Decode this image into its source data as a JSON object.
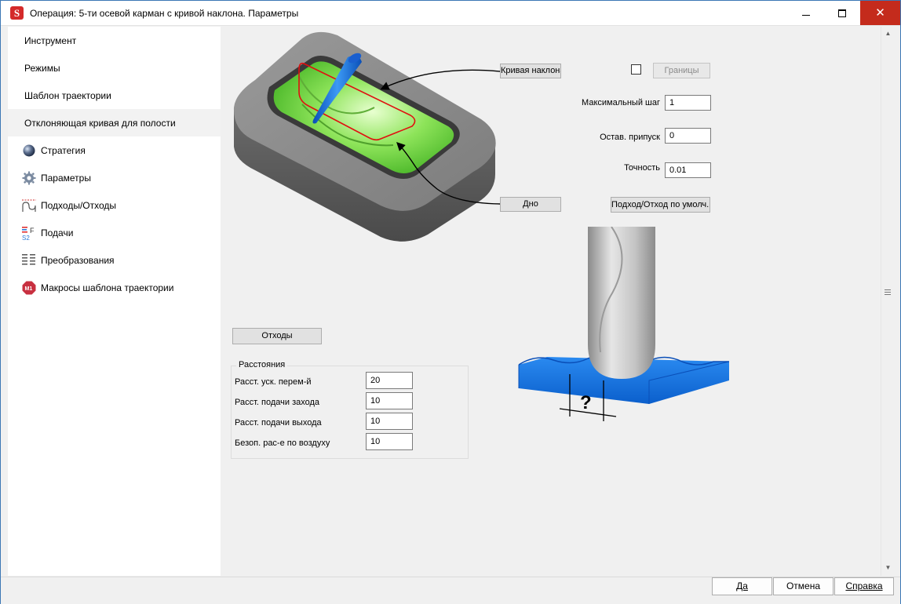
{
  "window": {
    "title": "Операция: 5-ти осевой карман с кривой наклона. Параметры",
    "app_icon_letter": "S"
  },
  "sidebar": {
    "items": [
      {
        "label": "Инструмент",
        "icon": null,
        "selected": false
      },
      {
        "label": "Режимы",
        "icon": null,
        "selected": false
      },
      {
        "label": "Шаблон траектории",
        "icon": null,
        "selected": false
      },
      {
        "label": "Отклоняющая кривая для полости",
        "icon": null,
        "selected": true
      },
      {
        "label": "Стратегия",
        "icon": "sphere-icon",
        "selected": false
      },
      {
        "label": "Параметры",
        "icon": "gear-icon",
        "selected": false
      },
      {
        "label": "Подходы/Отходы",
        "icon": "approach-retract-icon",
        "selected": false
      },
      {
        "label": "Подачи",
        "icon": "feeds-icon",
        "selected": false
      },
      {
        "label": "Преобразования",
        "icon": "transform-icon",
        "selected": false
      },
      {
        "label": "Макросы шаблона траектории",
        "icon": "macro-icon",
        "selected": false
      }
    ]
  },
  "params": {
    "tilt_curve_button": "Кривая наклона",
    "bottom_button": "Дно",
    "boundaries_checked": false,
    "boundaries_button": "Границы",
    "max_step_label": "Максимальный шаг",
    "max_step_value": "1",
    "stock_label": "Остав. припуск",
    "stock_value": "0",
    "accuracy_label": "Точность",
    "accuracy_value": "0.01",
    "default_approach_button": "Подход/Отход по умолч.",
    "retracts_button": "Отходы"
  },
  "distances": {
    "title": "Расстояния",
    "rapid_label": "Расст. уск. перем-й",
    "rapid_value": "20",
    "approach_feed_label": "Расст. подачи захода",
    "approach_feed_value": "10",
    "retract_feed_label": "Расст. подачи выхода",
    "retract_feed_value": "10",
    "safe_air_label": "Безоп. рас-е по воздуху",
    "safe_air_value": "10"
  },
  "illustration": {
    "question_mark": "?"
  },
  "dialog": {
    "ok": "Да",
    "cancel": "Отмена",
    "help": "Справка"
  },
  "colors": {
    "part_gray": "#8c8c8c",
    "pocket_green": "#7fe04f",
    "curve_red": "#e01010",
    "tool_blue": "#1a6fe0",
    "plate_blue": "#1e78e6",
    "close_red": "#c42b1c"
  }
}
